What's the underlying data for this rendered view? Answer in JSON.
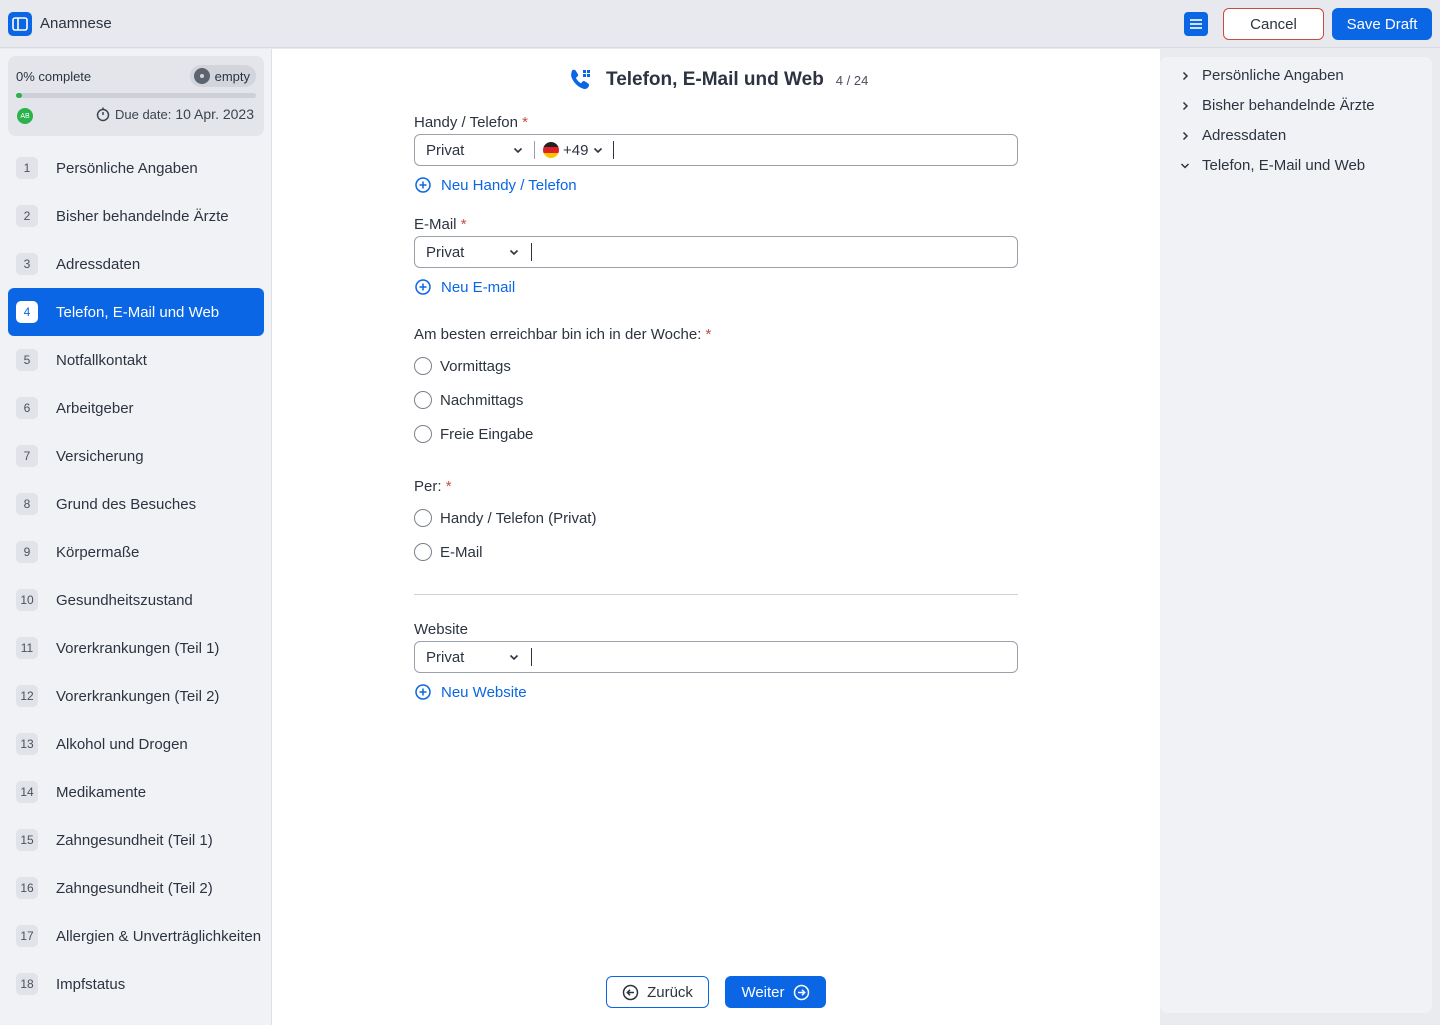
{
  "app": {
    "title": "Anamnese"
  },
  "toolbar": {
    "cancel_label": "Cancel",
    "save_label": "Save Draft"
  },
  "sidebar": {
    "progress": {
      "label": "0% complete",
      "status": "empty",
      "fraction": 0.0,
      "avatar": "AB",
      "due_label": "Due date:",
      "due_value": "10 Apr. 2023"
    },
    "steps": [
      {
        "num": "1",
        "label": "Persönliche Angaben"
      },
      {
        "num": "2",
        "label": "Bisher behandelnde Ärzte"
      },
      {
        "num": "3",
        "label": "Adressdaten"
      },
      {
        "num": "4",
        "label": "Telefon, E-Mail und Web",
        "active": true
      },
      {
        "num": "5",
        "label": "Notfallkontakt"
      },
      {
        "num": "6",
        "label": "Arbeitgeber"
      },
      {
        "num": "7",
        "label": "Versicherung"
      },
      {
        "num": "8",
        "label": "Grund des Besuches"
      },
      {
        "num": "9",
        "label": "Körpermaße"
      },
      {
        "num": "10",
        "label": "Gesundheitszustand"
      },
      {
        "num": "11",
        "label": "Vorerkrankungen (Teil 1)"
      },
      {
        "num": "12",
        "label": "Vorerkrankungen (Teil 2)"
      },
      {
        "num": "13",
        "label": "Alkohol und Drogen"
      },
      {
        "num": "14",
        "label": "Medikamente"
      },
      {
        "num": "15",
        "label": "Zahngesundheit (Teil 1)"
      },
      {
        "num": "16",
        "label": "Zahngesundheit (Teil 2)"
      },
      {
        "num": "17",
        "label": "Allergien & Unverträglichkeiten"
      },
      {
        "num": "18",
        "label": "Impfstatus"
      }
    ]
  },
  "main": {
    "title": "Telefon, E-Mail und Web",
    "counter": "4 / 24",
    "phone": {
      "label": "Handy / Telefon",
      "required": "*",
      "type": "Privat",
      "country_code": "+49",
      "value": "",
      "add_label": "Neu Handy / Telefon"
    },
    "email": {
      "label": "E-Mail",
      "required": "*",
      "type": "Privat",
      "value": "",
      "add_label": "Neu E-mail"
    },
    "availability": {
      "label": "Am besten erreichbar bin ich in der Woche:",
      "required": "*",
      "options": [
        "Vormittags",
        "Nachmittags",
        "Freie Eingabe"
      ]
    },
    "contact_via": {
      "label": "Per:",
      "required": "*",
      "options": [
        "Handy / Telefon (Privat)",
        "E-Mail"
      ]
    },
    "website": {
      "label": "Website",
      "type": "Privat",
      "value": "",
      "add_label": "Neu Website"
    },
    "back_label": "Zurück",
    "next_label": "Weiter"
  },
  "toc": {
    "items": [
      {
        "label": "Persönliche Angaben",
        "expanded": false
      },
      {
        "label": "Bisher behandelnde Ärzte",
        "expanded": false
      },
      {
        "label": "Adressdaten",
        "expanded": false
      },
      {
        "label": "Telefon, E-Mail und Web",
        "expanded": true
      }
    ]
  },
  "colors": {
    "accent": "#0a66e4",
    "success": "#2bb24c",
    "danger": "#c94a44"
  }
}
